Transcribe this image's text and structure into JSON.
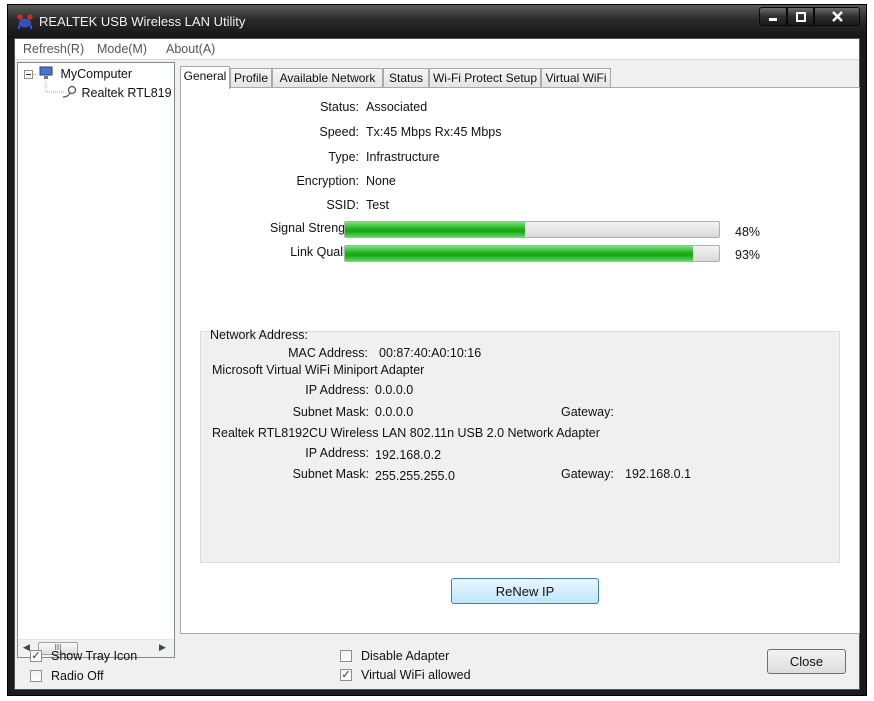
{
  "window": {
    "title": "REALTEK USB Wireless LAN Utility"
  },
  "menu": [
    "Refresh(R)",
    "Mode(M)",
    "About(A)"
  ],
  "tree": {
    "root": "MyComputer",
    "child": "Realtek RTL819",
    "scroll_thumb": "III"
  },
  "tabs": [
    "General",
    "Profile",
    "Available Network",
    "Status",
    "Wi-Fi Protect Setup",
    "Virtual WiFi"
  ],
  "general": {
    "status_label": "Status:",
    "status": "Associated",
    "speed_label": "Speed:",
    "speed": "Tx:45 Mbps Rx:45 Mbps",
    "type_label": "Type:",
    "type": "Infrastructure",
    "encryption_label": "Encryption:",
    "encryption": "None",
    "ssid_label": "SSID:",
    "ssid": "Test",
    "signal_label": "Signal Strength:",
    "signal_text": "48%",
    "signal_value": 0.48,
    "link_label": "Link Quality:",
    "link_text": "93%",
    "link_value": 0.93
  },
  "network": {
    "heading": "Network Address:",
    "mac_label": "MAC Address:",
    "mac": "00:87:40:A0:10:16",
    "adapter1": "Microsoft Virtual WiFi Miniport Adapter",
    "ip_label": "IP Address:",
    "a1_ip": "0.0.0.0",
    "mask_label": "Subnet Mask:",
    "a1_mask": "0.0.0.0",
    "gateway_label": "Gateway:",
    "a1_gateway": "",
    "adapter2": "Realtek RTL8192CU Wireless LAN 802.11n USB 2.0 Network Adapter",
    "a2_ip": "192.168.0.2",
    "a2_mask": "255.255.255.0",
    "a2_gateway": "192.168.0.1"
  },
  "renew_label": "ReNew IP",
  "options": {
    "show_tray": "Show Tray Icon",
    "show_tray_checked": true,
    "radio_off": "Radio Off",
    "radio_off_checked": false,
    "disable_adapter": "Disable Adapter",
    "disable_adapter_checked": false,
    "virtual_wifi": "Virtual WiFi allowed",
    "virtual_wifi_checked": true
  },
  "close_label": "Close",
  "colors": {
    "progress_green": "#1fb51f",
    "button_blue": "#3c7fb1"
  }
}
